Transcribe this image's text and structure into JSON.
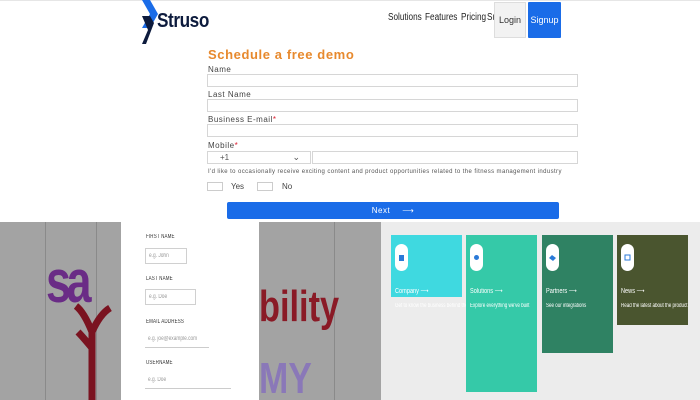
{
  "header": {
    "logo_text": "Struso",
    "nav": [
      "Solutions",
      "Features",
      "Pricing",
      "Support"
    ],
    "login_label": "Login",
    "signup_label": "Signup"
  },
  "demo_form": {
    "title": "Schedule a free demo",
    "name_label": "Name",
    "last_name_label": "Last Name",
    "email_label": "Business E-mail",
    "mobile_label": "Mobile",
    "required_mark": "*",
    "country_code": "+1",
    "consent_text": "I'd like to occasionally receive exciting content and product opportunities related to the fitness management industry",
    "yes_label": "Yes",
    "no_label": "No",
    "next_label": "Next",
    "next_arrow": "⟶"
  },
  "signup_form": {
    "first_name_label": "FIRST NAME",
    "first_name_placeholder": "e.g. John",
    "last_name_label": "LAST NAME",
    "last_name_placeholder": "e.g. Doe",
    "email_label": "EMAIL ADDRESS",
    "email_placeholder": "e.g. joe@example.com",
    "username_label": "USERNAME",
    "username_placeholder": "e.g. Doe"
  },
  "background_art": {
    "left_text": "sa",
    "right_text": "bility",
    "right_text_2": "MY"
  },
  "cards": [
    {
      "title": "Company ⟶",
      "desc": "Get to know the business behind the platform",
      "color": "#3fd9e0"
    },
    {
      "title": "Solutions ⟶",
      "desc": "Explore everything we've built",
      "color": "#35c9a8"
    },
    {
      "title": "Partners ⟶",
      "desc": "See our integrations",
      "color": "#2f8263"
    },
    {
      "title": "News ⟶",
      "desc": "Read the latest about the product",
      "color": "#4a552f"
    }
  ],
  "colors": {
    "brand_blue": "#1a6ce8",
    "title_orange": "#e7892d"
  }
}
